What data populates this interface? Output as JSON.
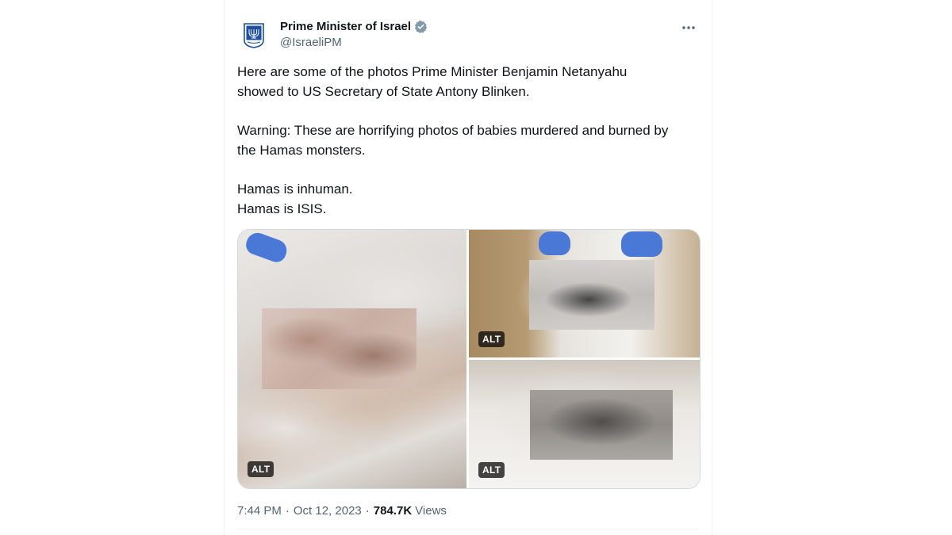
{
  "tweet": {
    "author_name": "Prime Minister of Israel",
    "handle": "@IsraeliPM",
    "paragraphs": [
      [
        "Here are some of the photos Prime Minister Benjamin Netanyahu",
        "showed to US Secretary of State Antony Blinken."
      ],
      [
        "Warning: These are horrifying photos of babies murdered and burned by",
        "the Hamas monsters."
      ],
      [
        "Hamas is inhuman.",
        "Hamas is ISIS."
      ]
    ],
    "media": {
      "alt_badges": [
        "ALT",
        "ALT",
        "ALT"
      ]
    },
    "time": "7:44 PM",
    "separator": "·",
    "date": "Oct 12, 2023",
    "views_count": "784.7K",
    "views_label": "Views"
  },
  "icons": {
    "avatar": "menorah-emblem-icon",
    "verified": "verified-badge-icon",
    "more": "more-options-icon"
  },
  "colors": {
    "text_primary": "#0f1419",
    "text_secondary": "#536471",
    "verified_badge": "#829aab",
    "emblem_blue": "#1f4fa0"
  }
}
